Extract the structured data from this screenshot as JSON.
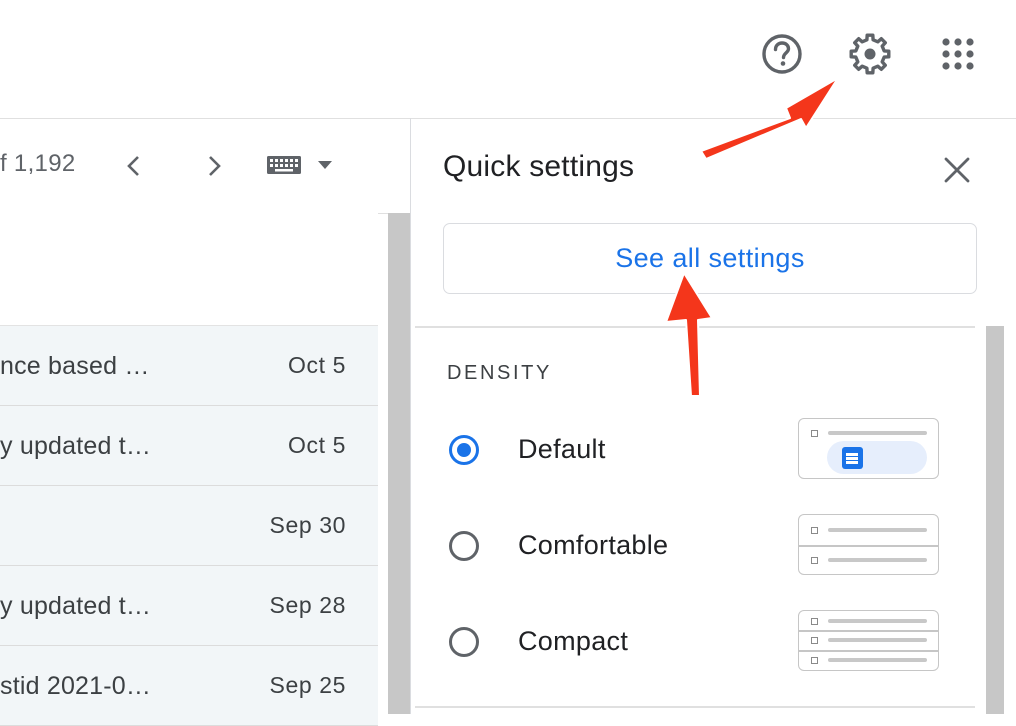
{
  "header": {
    "help_icon": "help-circle-icon",
    "settings_icon": "gear-icon",
    "apps_icon": "apps-grid-icon"
  },
  "toolbar": {
    "count_text": "f 1,192",
    "prev_icon": "chevron-left-icon",
    "next_icon": "chevron-right-icon",
    "keyboard_icon": "keyboard-icon",
    "dropdown_icon": "caret-down-icon"
  },
  "mail": {
    "rows": [
      {
        "snippet": "nce based …",
        "date": "Oct 5"
      },
      {
        "snippet": "y updated t…",
        "date": "Oct 5"
      },
      {
        "snippet": "",
        "date": "Sep 30"
      },
      {
        "snippet": "y updated t…",
        "date": "Sep 28"
      },
      {
        "snippet": "stid 2021-0…",
        "date": "Sep 25"
      }
    ]
  },
  "quick_settings": {
    "title": "Quick settings",
    "close_icon": "close-icon",
    "see_all_label": "See all settings",
    "density_label": "DENSITY",
    "options": [
      {
        "label": "Default",
        "checked": true
      },
      {
        "label": "Comfortable",
        "checked": false
      },
      {
        "label": "Compact",
        "checked": false
      }
    ]
  },
  "colors": {
    "accent": "#1a73e8",
    "annotation_arrow": "#f4361b",
    "row_bg": "#f2f6f8"
  }
}
